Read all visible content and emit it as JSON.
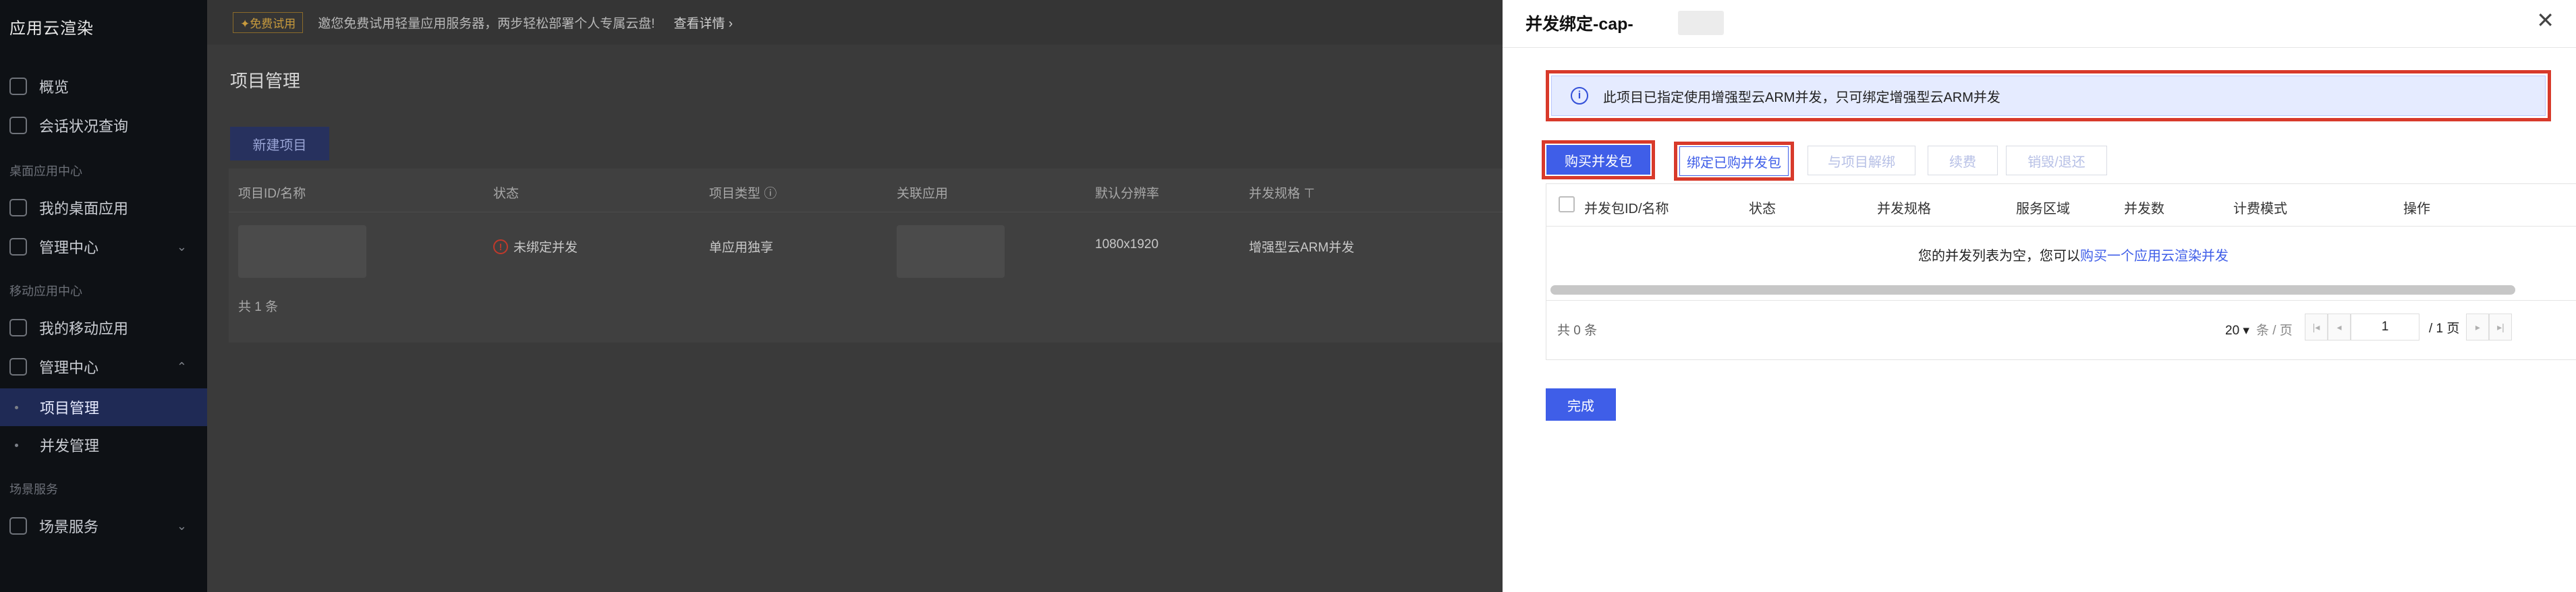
{
  "sidebar": {
    "brand": "应用云渲染",
    "items": {
      "overview": "概览",
      "session": "会话状况查询",
      "group_desktop": "桌面应用中心",
      "desktop_apps": "我的桌面应用",
      "desktop_manage": "管理中心",
      "group_mobile": "移动应用中心",
      "mobile_apps": "我的移动应用",
      "mobile_manage": "管理中心",
      "project_manage": "项目管理",
      "concurrency_manage": "并发管理",
      "group_scene": "场景服务",
      "scene_services": "场景服务"
    }
  },
  "main": {
    "banner": {
      "tag": "✦免费试用",
      "text": "邀您免费试用轻量应用服务器，两步轻松部署个人专属云盘!",
      "link": "查看详情 ›"
    },
    "page_title": "项目管理",
    "create_button": "新建项目",
    "table": {
      "headers": {
        "id": "项目ID/名称",
        "status": "状态",
        "type": "项目类型 ⓘ",
        "app": "关联应用",
        "resolution": "默认分辨率",
        "spec": "并发规格 ⊤"
      },
      "row": {
        "status": "未绑定并发",
        "type": "单应用独享",
        "resolution": "1080x1920",
        "spec": "增强型云ARM并发"
      },
      "total": "共 1 条"
    }
  },
  "drawer": {
    "title": "并发绑定-cap-",
    "close": "✕",
    "notice": "此项目已指定使用增强型云ARM并发，只可绑定增强型云ARM并发",
    "buttons": {
      "buy": "购买并发包",
      "bind": "绑定已购并发包",
      "unbind": "与项目解绑",
      "renew": "续费",
      "destroy": "销毁/退还"
    },
    "table": {
      "headers": {
        "id": "并发包ID/名称",
        "status": "状态",
        "spec": "并发规格",
        "region": "服务区域",
        "count": "并发数",
        "billing": "计费模式",
        "action": "操作"
      },
      "empty_prefix": "您的并发列表为空，您可以",
      "empty_link": "购买一个应用云渲染并发",
      "total": "共 0 条",
      "page_size": "20 ▾",
      "page_size_unit": "条 / 页",
      "page": "1",
      "page_total": "/ 1 页"
    },
    "done": "完成"
  }
}
